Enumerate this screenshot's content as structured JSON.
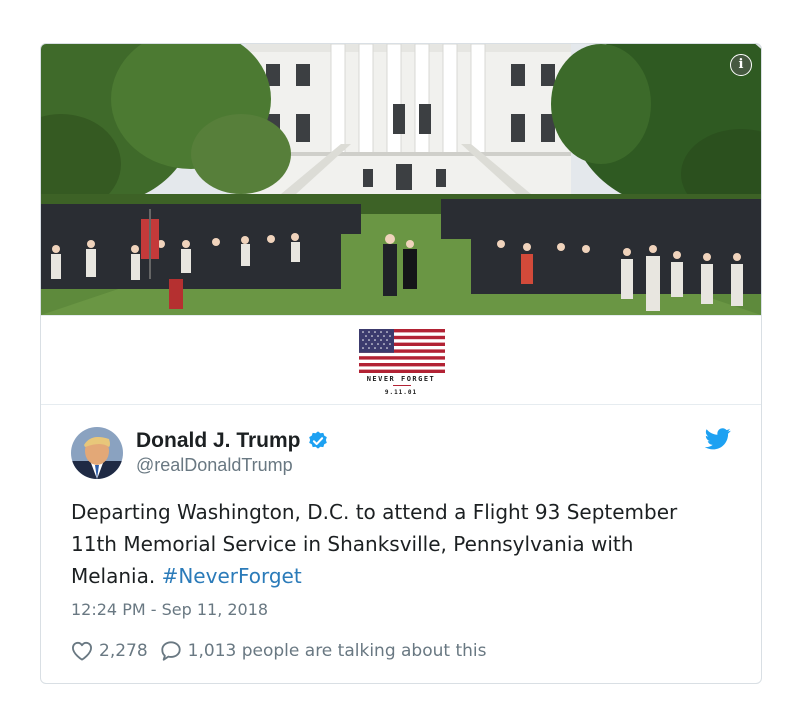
{
  "tweet": {
    "display_name": "Donald J. Trump",
    "handle": "@realDonaldTrump",
    "text_before": "Departing Washington, D.C. to attend a Flight 93 September 11th Memorial Service in Shanksville, Pennsylvania with Melania. ",
    "hashtag": "#NeverForget",
    "timestamp": "12:24 PM - Sep 11, 2018",
    "likes": "2,278",
    "conversation": "1,013 people are talking about this"
  },
  "media": {
    "info_glyph": "i",
    "banner_line1": "NEVER FORGET",
    "banner_line2": "9.11.01"
  },
  "icons": {
    "info": "info-icon",
    "verified": "verified-badge-icon",
    "bird": "twitter-bird-icon",
    "like": "heart-icon",
    "reply": "speech-bubble-icon"
  },
  "colors": {
    "link": "#2b7bb9",
    "verified": "#1da1f2",
    "secondary_text": "#697882",
    "primary_text": "#1c2022"
  }
}
